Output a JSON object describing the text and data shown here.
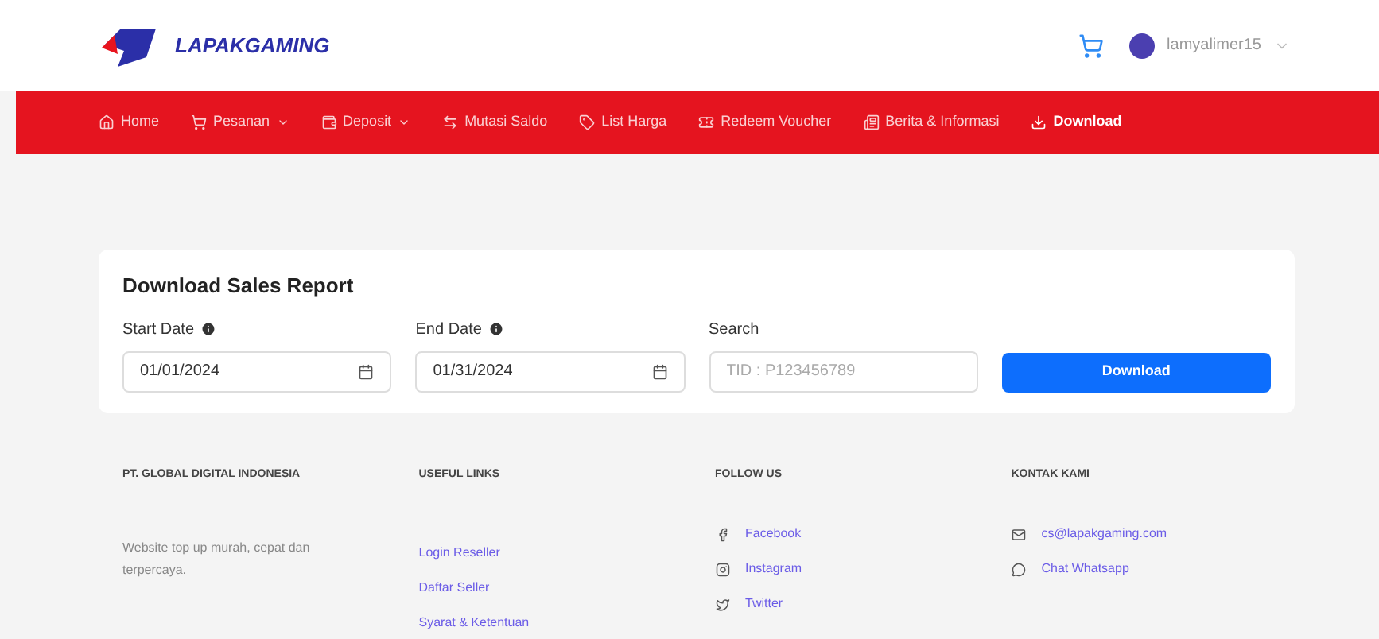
{
  "header": {
    "logo": "LAPAKGAMING",
    "username": "lamyalimer15"
  },
  "nav": [
    {
      "label": "Home",
      "dropdown": false,
      "selected": false
    },
    {
      "label": "Pesanan",
      "dropdown": true,
      "selected": false
    },
    {
      "label": "Deposit",
      "dropdown": true,
      "selected": false
    },
    {
      "label": "Mutasi Saldo",
      "dropdown": false,
      "selected": false
    },
    {
      "label": "List Harga",
      "dropdown": false,
      "selected": false
    },
    {
      "label": "Redeem Voucher",
      "dropdown": false,
      "selected": false
    },
    {
      "label": "Berita & Informasi",
      "dropdown": false,
      "selected": false
    },
    {
      "label": "Download",
      "dropdown": false,
      "selected": true
    }
  ],
  "report": {
    "title": "Download Sales Report",
    "fields": [
      {
        "label": "Start Date",
        "kind": "date",
        "info": true,
        "value": "01/01/2024"
      },
      {
        "label": "End Date",
        "kind": "date",
        "info": true,
        "value": "01/31/2024"
      },
      {
        "label": "Search",
        "kind": "text",
        "info": false,
        "placeholder": "TID : P123456789"
      }
    ],
    "button": "Download"
  },
  "footer": [
    {
      "heading": "PT. GLOBAL DIGITAL INDONESIA",
      "text": "Website top up murah, cepat dan terpercaya."
    },
    {
      "heading": "USEFUL LINKS",
      "links": [
        {
          "label": "Login Reseller"
        },
        {
          "label": "Daftar Seller"
        },
        {
          "label": "Syarat & Ketentuan"
        }
      ]
    },
    {
      "heading": "FOLLOW US",
      "links": [
        {
          "label": "Facebook"
        },
        {
          "label": "Instagram"
        },
        {
          "label": "Twitter"
        }
      ]
    },
    {
      "heading": "KONTAK KAMI",
      "links": [
        {
          "label": "cs@lapakgaming.com"
        },
        {
          "label": "Chat Whatsapp"
        }
      ]
    }
  ]
}
